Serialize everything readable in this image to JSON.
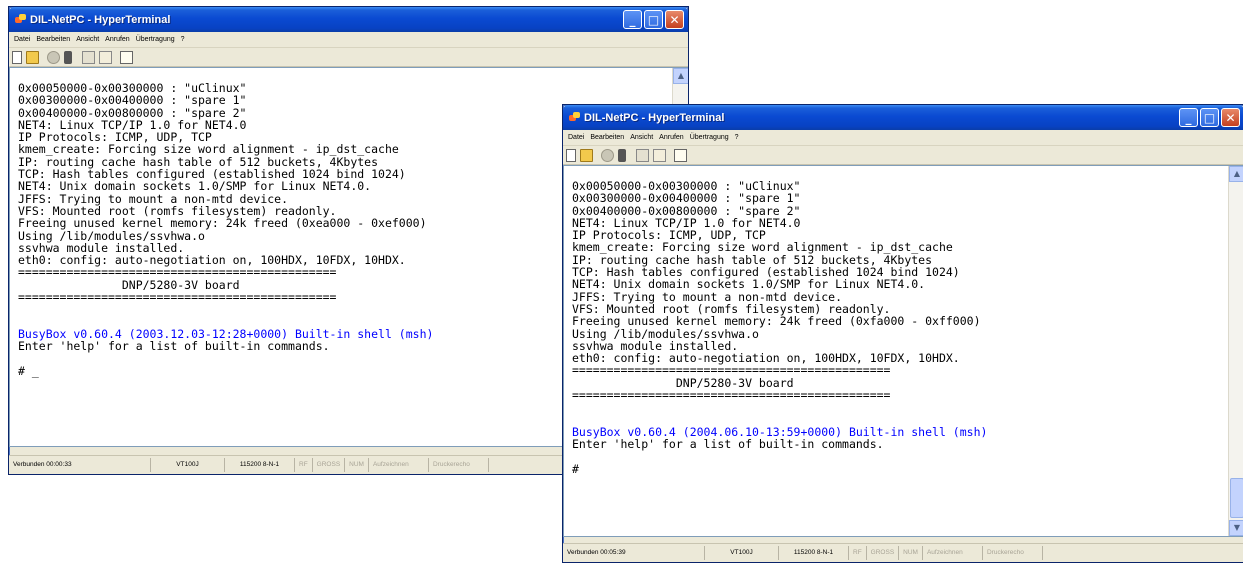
{
  "windows": [
    {
      "title": "DIL-NetPC - HyperTerminal",
      "menu": [
        "Datei",
        "Bearbeiten",
        "Ansicht",
        "Anrufen",
        "Übertragung",
        "?"
      ],
      "toolbar_icons": [
        "new-icon",
        "open-icon",
        "disconnect-icon",
        "dial-icon",
        "send-icon",
        "receive-icon",
        "properties-icon"
      ],
      "terminal_lines": [
        {
          "text": "0x00050000-0x00300000 : \"uClinux\"",
          "color": "#000000"
        },
        {
          "text": "0x00300000-0x00400000 : \"spare 1\"",
          "color": "#000000"
        },
        {
          "text": "0x00400000-0x00800000 : \"spare 2\"",
          "color": "#000000"
        },
        {
          "text": "NET4: Linux TCP/IP 1.0 for NET4.0",
          "color": "#000000"
        },
        {
          "text": "IP Protocols: ICMP, UDP, TCP",
          "color": "#000000"
        },
        {
          "text": "kmem_create: Forcing size word alignment - ip_dst_cache",
          "color": "#000000"
        },
        {
          "text": "IP: routing cache hash table of 512 buckets, 4Kbytes",
          "color": "#000000"
        },
        {
          "text": "TCP: Hash tables configured (established 1024 bind 1024)",
          "color": "#000000"
        },
        {
          "text": "NET4: Unix domain sockets 1.0/SMP for Linux NET4.0.",
          "color": "#000000"
        },
        {
          "text": "JFFS: Trying to mount a non-mtd device.",
          "color": "#000000"
        },
        {
          "text": "VFS: Mounted root (romfs filesystem) readonly.",
          "color": "#000000"
        },
        {
          "text": "Freeing unused kernel memory: 24k freed (0xea000 - 0xef000)",
          "color": "#000000"
        },
        {
          "text": "Using /lib/modules/ssvhwa.o",
          "color": "#000000"
        },
        {
          "text": "ssvhwa module installed.",
          "color": "#000000"
        },
        {
          "text": "eth0: config: auto-negotiation on, 100HDX, 10FDX, 10HDX.",
          "color": "#000000"
        },
        {
          "text": "==============================================",
          "color": "#000000"
        },
        {
          "text": "               DNP/5280-3V board",
          "color": "#000000"
        },
        {
          "text": "==============================================",
          "color": "#000000"
        },
        {
          "text": "",
          "color": "#000000"
        },
        {
          "text": "",
          "color": "#000000"
        },
        {
          "text": "BusyBox v0.60.4 (2003.12.03-12:28+0000) Built-in shell (msh)",
          "color": "#0000ff"
        },
        {
          "text": "Enter 'help' for a list of built-in commands.",
          "color": "#000000"
        },
        {
          "text": "",
          "color": "#000000"
        },
        {
          "text": "# _",
          "color": "#000000"
        }
      ],
      "status": {
        "connected": "Verbunden 00:00:33",
        "emulation": "VT100J",
        "settings": "115200 8-N-1",
        "rf": "RF",
        "gross": "GROSS",
        "num": "NUM",
        "capture": "Aufzeichnen",
        "print_echo": "Druckerecho"
      }
    },
    {
      "title": "DIL-NetPC - HyperTerminal",
      "menu": [
        "Datei",
        "Bearbeiten",
        "Ansicht",
        "Anrufen",
        "Übertragung",
        "?"
      ],
      "toolbar_icons": [
        "new-icon",
        "open-icon",
        "disconnect-icon",
        "dial-icon",
        "send-icon",
        "receive-icon",
        "properties-icon"
      ],
      "terminal_lines": [
        {
          "text": "0x00050000-0x00300000 : \"uClinux\"",
          "color": "#000000"
        },
        {
          "text": "0x00300000-0x00400000 : \"spare 1\"",
          "color": "#000000"
        },
        {
          "text": "0x00400000-0x00800000 : \"spare 2\"",
          "color": "#000000"
        },
        {
          "text": "NET4: Linux TCP/IP 1.0 for NET4.0",
          "color": "#000000"
        },
        {
          "text": "IP Protocols: ICMP, UDP, TCP",
          "color": "#000000"
        },
        {
          "text": "kmem_create: Forcing size word alignment - ip_dst_cache",
          "color": "#000000"
        },
        {
          "text": "IP: routing cache hash table of 512 buckets, 4Kbytes",
          "color": "#000000"
        },
        {
          "text": "TCP: Hash tables configured (established 1024 bind 1024)",
          "color": "#000000"
        },
        {
          "text": "NET4: Unix domain sockets 1.0/SMP for Linux NET4.0.",
          "color": "#000000"
        },
        {
          "text": "JFFS: Trying to mount a non-mtd device.",
          "color": "#000000"
        },
        {
          "text": "VFS: Mounted root (romfs filesystem) readonly.",
          "color": "#000000"
        },
        {
          "text": "Freeing unused kernel memory: 24k freed (0xfa000 - 0xff000)",
          "color": "#000000"
        },
        {
          "text": "Using /lib/modules/ssvhwa.o",
          "color": "#000000"
        },
        {
          "text": "ssvhwa module installed.",
          "color": "#000000"
        },
        {
          "text": "eth0: config: auto-negotiation on, 100HDX, 10FDX, 10HDX.",
          "color": "#000000"
        },
        {
          "text": "==============================================",
          "color": "#000000"
        },
        {
          "text": "               DNP/5280-3V board",
          "color": "#000000"
        },
        {
          "text": "==============================================",
          "color": "#000000"
        },
        {
          "text": "",
          "color": "#000000"
        },
        {
          "text": "",
          "color": "#000000"
        },
        {
          "text": "BusyBox v0.60.4 (2004.06.10-13:59+0000) Built-in shell (msh)",
          "color": "#0000ff"
        },
        {
          "text": "Enter 'help' for a list of built-in commands.",
          "color": "#000000"
        },
        {
          "text": "",
          "color": "#000000"
        },
        {
          "text": "#",
          "color": "#000000"
        }
      ],
      "status": {
        "connected": "Verbunden 00:05:39",
        "emulation": "VT100J",
        "settings": "115200 8-N-1",
        "rf": "RF",
        "gross": "GROSS",
        "num": "NUM",
        "capture": "Aufzeichnen",
        "print_echo": "Druckerecho"
      }
    }
  ]
}
